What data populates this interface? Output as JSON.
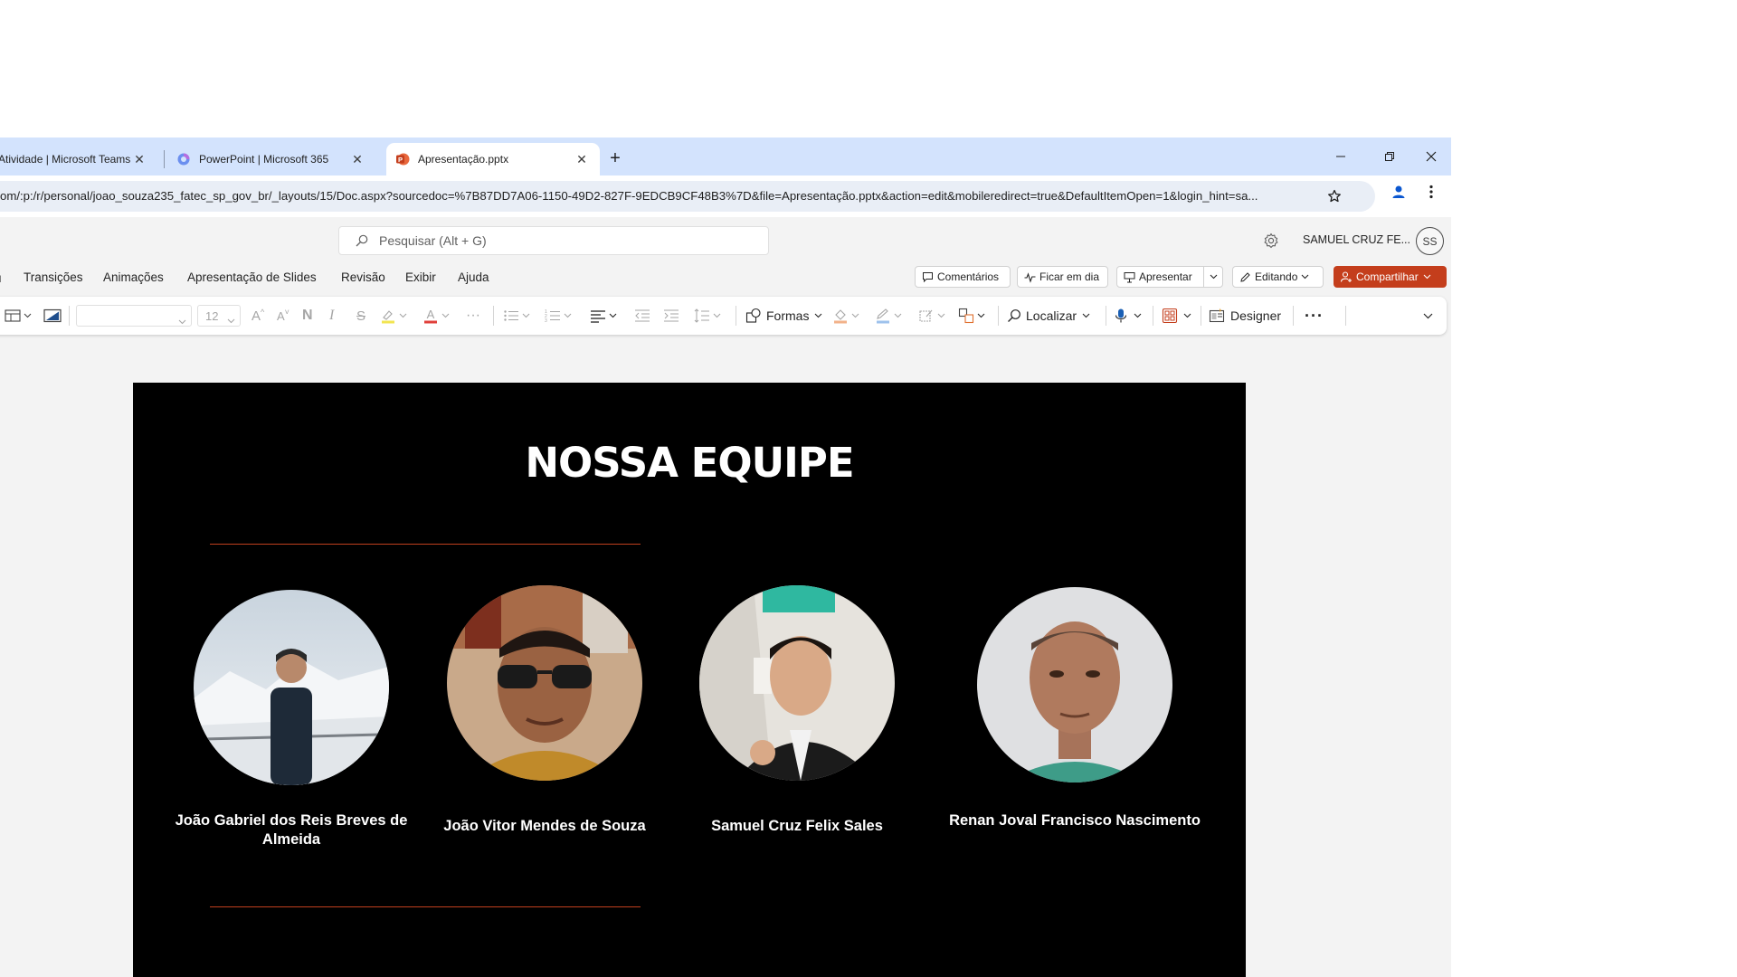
{
  "browser": {
    "tabs": [
      {
        "label": "Atividade | Microsoft Teams",
        "icon": "teams-icon"
      },
      {
        "label": "PowerPoint | Microsoft 365",
        "icon": "m365-copilot-icon"
      },
      {
        "label": "Apresentação.pptx",
        "icon": "powerpoint-icon",
        "active": true
      }
    ],
    "url": "om/:p:/r/personal/joao_souza235_fatec_sp_gov_br/_layouts/15/Doc.aspx?sourcedoc=%7B87DD7A06-1150-49D2-827F-9EDCB9CF48B3%7D&file=Apresentação.pptx&action=edit&mobileredirect=true&DefaultItemOpen=1&login_hint=sa..."
  },
  "office": {
    "search_placeholder": "Pesquisar (Alt + G)",
    "user_name": "SAMUEL CRUZ FE...",
    "avatar_initials": "SS",
    "accent_color": "#c43e1c"
  },
  "ribbon": {
    "tabs": [
      "Transições",
      "Animações",
      "Apresentação de Slides",
      "Revisão",
      "Exibir",
      "Ajuda"
    ],
    "comments": "Comentários",
    "catch_up": "Ficar em dia",
    "present": "Apresentar",
    "editing": "Editando",
    "share": "Compartilhar"
  },
  "commands": {
    "font_size": "12",
    "shapes": "Formas",
    "find": "Localizar",
    "designer": "Designer"
  },
  "slide": {
    "title": "NOSSA EQUIPE",
    "members": [
      {
        "name": "João Gabriel dos Reis Breves de Almeida"
      },
      {
        "name": "João Vitor Mendes de Souza"
      },
      {
        "name": "Samuel Cruz Felix Sales"
      },
      {
        "name": "Renan Joval Francisco Nascimento"
      }
    ]
  }
}
